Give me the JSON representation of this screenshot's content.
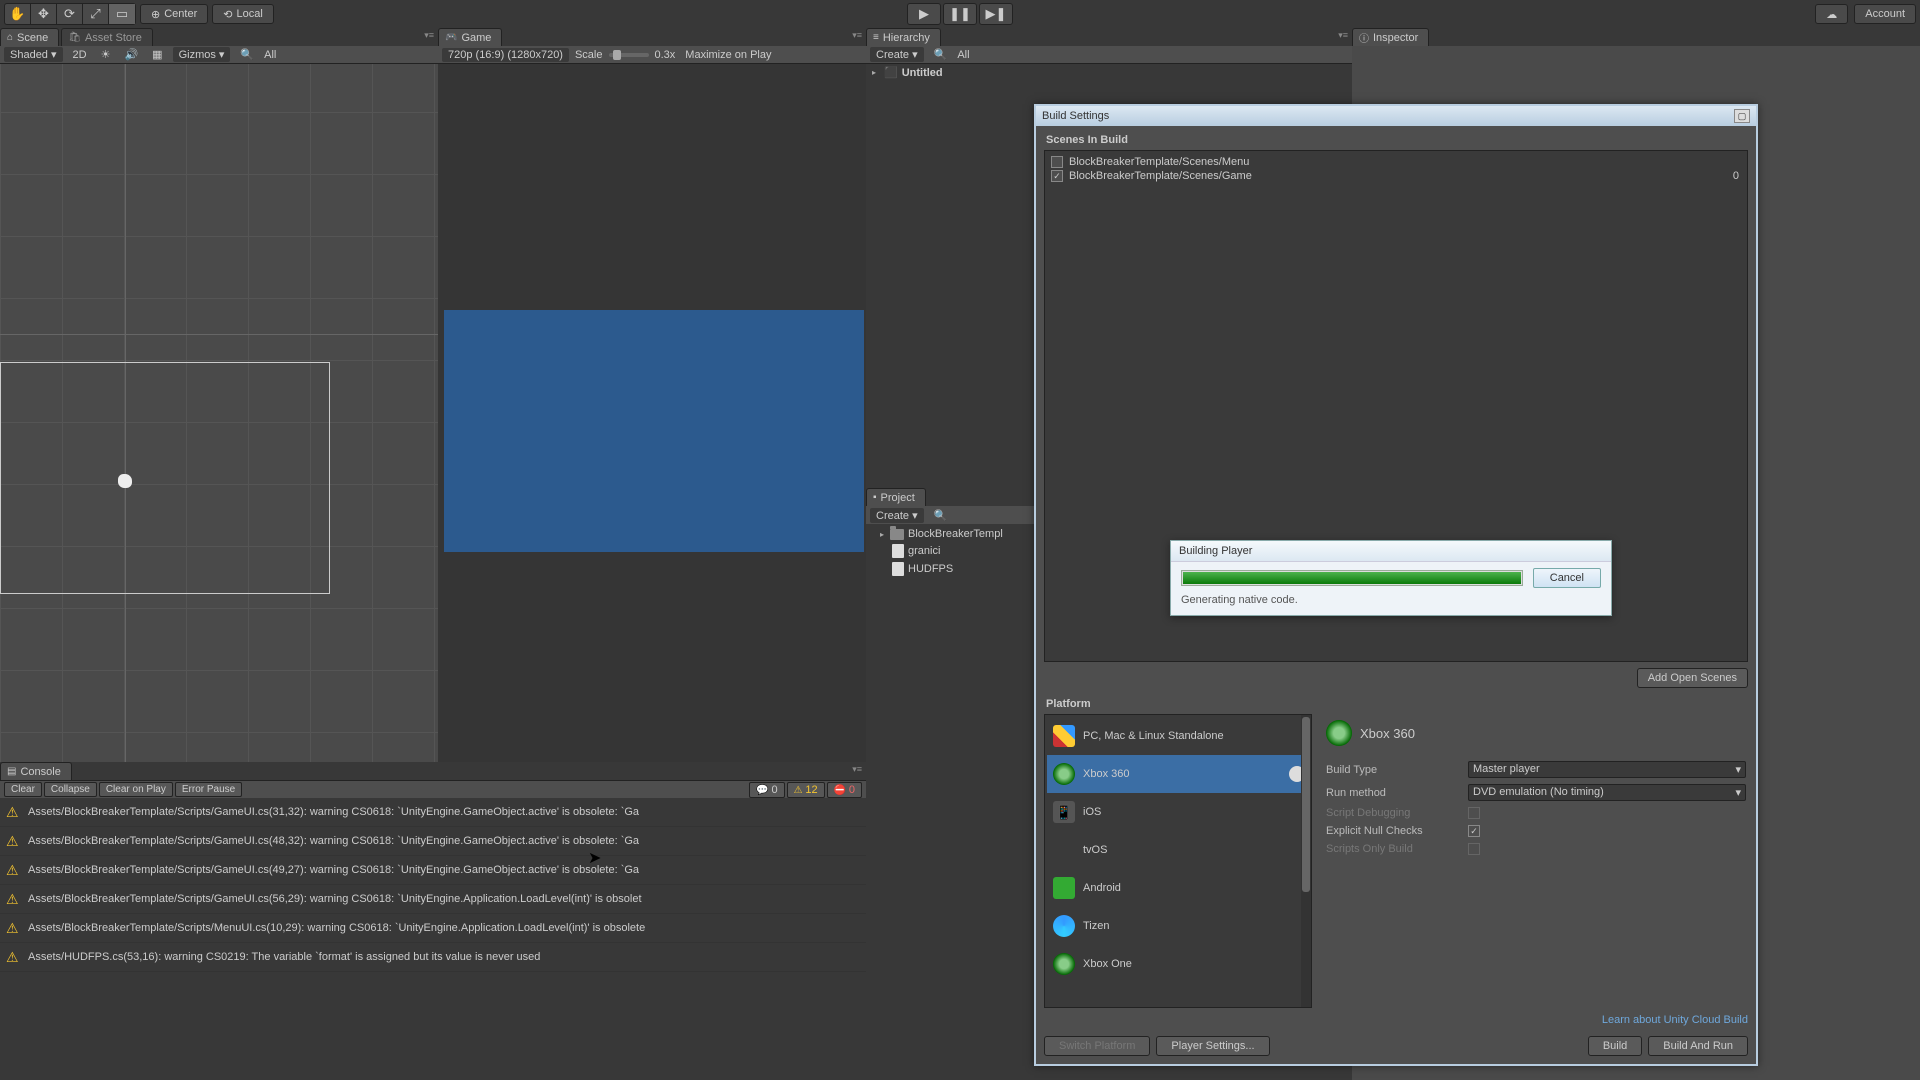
{
  "toolbar": {
    "center": "Center",
    "local": "Local",
    "account": "Account"
  },
  "tabs": {
    "scene": "Scene",
    "asset_store": "Asset Store",
    "game": "Game",
    "hierarchy": "Hierarchy",
    "project": "Project",
    "inspector": "Inspector",
    "console": "Console"
  },
  "scene_toolbar": {
    "shaded": "Shaded",
    "d2": "2D",
    "gizmos": "Gizmos",
    "all": "All"
  },
  "game_toolbar": {
    "aspect": "720p (16:9) (1280x720)",
    "scale": "Scale",
    "scale_val": "0.3x",
    "maximize": "Maximize on Play"
  },
  "hierarchy": {
    "create": "Create",
    "all": "All",
    "root": "Untitled"
  },
  "project": {
    "create": "Create",
    "items": [
      "BlockBreakerTempl",
      "granici",
      "HUDFPS"
    ]
  },
  "console": {
    "clear": "Clear",
    "collapse": "Collapse",
    "clear_on_play": "Clear on Play",
    "error_pause": "Error Pause",
    "info_count": "0",
    "warn_count": "12",
    "err_count": "0",
    "logs": [
      "Assets/BlockBreakerTemplate/Scripts/GameUI.cs(31,32): warning CS0618: `UnityEngine.GameObject.active' is obsolete: `Ga",
      "Assets/BlockBreakerTemplate/Scripts/GameUI.cs(48,32): warning CS0618: `UnityEngine.GameObject.active' is obsolete: `Ga",
      "Assets/BlockBreakerTemplate/Scripts/GameUI.cs(49,27): warning CS0618: `UnityEngine.GameObject.active' is obsolete: `Ga",
      "Assets/BlockBreakerTemplate/Scripts/GameUI.cs(56,29): warning CS0618: `UnityEngine.Application.LoadLevel(int)' is obsolet",
      "Assets/BlockBreakerTemplate/Scripts/MenuUI.cs(10,29): warning CS0618: `UnityEngine.Application.LoadLevel(int)' is obsolete",
      "Assets/HUDFPS.cs(53,16): warning CS0219: The variable `format' is assigned but its value is never used"
    ]
  },
  "build": {
    "title": "Build Settings",
    "scenes_head": "Scenes In Build",
    "scenes": [
      {
        "checked": false,
        "path": "BlockBreakerTemplate/Scenes/Menu",
        "idx": ""
      },
      {
        "checked": true,
        "path": "BlockBreakerTemplate/Scenes/Game",
        "idx": "0"
      }
    ],
    "add_open": "Add Open Scenes",
    "platform_head": "Platform",
    "platforms": [
      "PC, Mac & Linux Standalone",
      "Xbox 360",
      "iOS",
      "tvOS",
      "Android",
      "Tizen",
      "Xbox One"
    ],
    "selected_platform": "Xbox 360",
    "opts": {
      "build_type_lbl": "Build Type",
      "build_type_val": "Master player",
      "run_method_lbl": "Run method",
      "run_method_val": "DVD emulation (No timing)",
      "script_debug_lbl": "Script Debugging",
      "explicit_null_lbl": "Explicit Null Checks",
      "scripts_only_lbl": "Scripts Only Build"
    },
    "cloud_link": "Learn about Unity Cloud Build",
    "switch_platform": "Switch Platform",
    "player_settings": "Player Settings...",
    "build_btn": "Build",
    "build_run_btn": "Build And Run"
  },
  "progress": {
    "title": "Building Player",
    "msg": "Generating native code.",
    "cancel": "Cancel"
  }
}
